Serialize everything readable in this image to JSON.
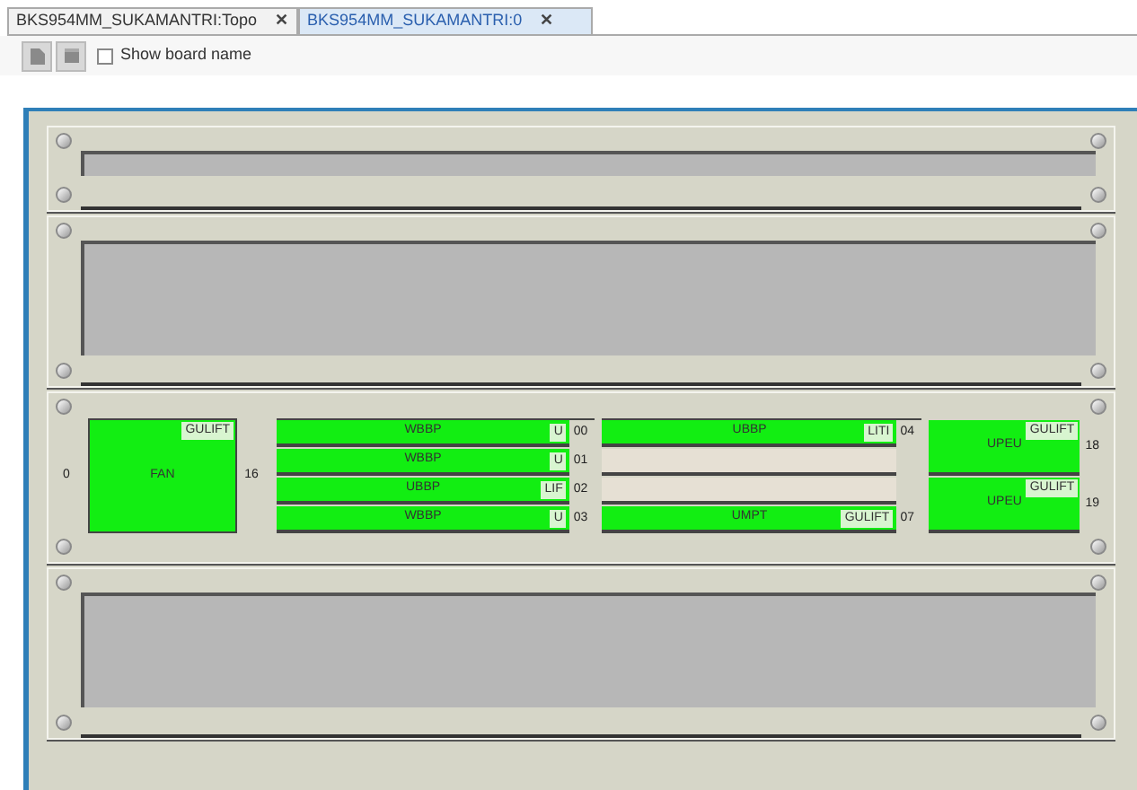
{
  "tabs": [
    {
      "label": "BKS954MM_SUKAMANTRI:Topo",
      "selected": false,
      "close": "✕"
    },
    {
      "label": "BKS954MM_SUKAMANTRI:0",
      "selected": true,
      "close": "✕"
    }
  ],
  "toolbar": {
    "show_board_name": {
      "label": "Show board name",
      "checked": false
    }
  },
  "subracks": [
    {
      "kind": "short"
    },
    {
      "kind": "tall"
    },
    {
      "kind": "boards",
      "fan": {
        "left_number": "0",
        "name": "FAN",
        "tag": "GULIFT",
        "right_number": "16"
      },
      "column_1": [
        {
          "name": "WBBP",
          "tag": "U",
          "number": "00",
          "occupied": true
        },
        {
          "name": "WBBP",
          "tag": "U",
          "number": "01",
          "occupied": true
        },
        {
          "name": "UBBP",
          "tag": "LIF",
          "number": "02",
          "occupied": true
        },
        {
          "name": "WBBP",
          "tag": "U",
          "number": "03",
          "occupied": true
        }
      ],
      "column_2": [
        {
          "name": "UBBP",
          "tag": "LITI",
          "number": "04",
          "occupied": true
        },
        {
          "occupied": false
        },
        {
          "occupied": false
        },
        {
          "name": "UMPT",
          "tag": "GULIFT",
          "number": "07",
          "occupied": true
        }
      ],
      "power": [
        {
          "name": "UPEU",
          "tag": "GULIFT",
          "number": "18"
        },
        {
          "name": "UPEU",
          "tag": "GULIFT",
          "number": "19"
        }
      ]
    },
    {
      "kind": "tall"
    }
  ]
}
